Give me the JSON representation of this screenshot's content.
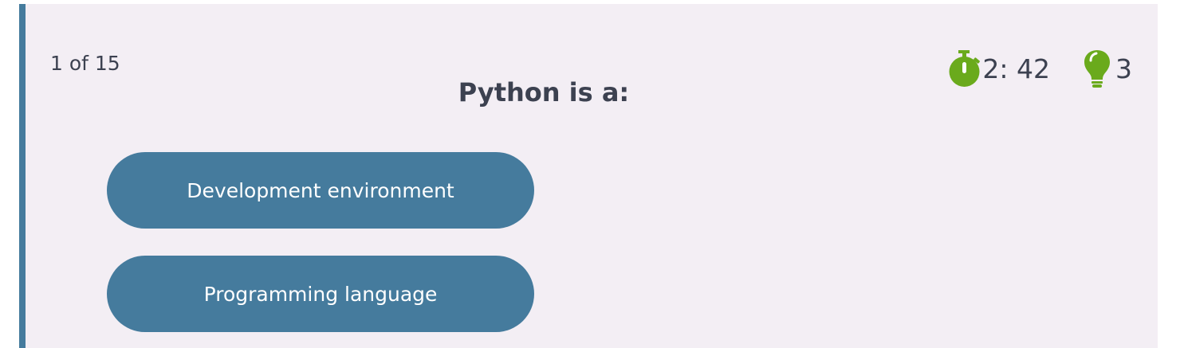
{
  "quiz": {
    "progress": "1 of 15",
    "question": "Python is a:",
    "timer": {
      "icon": "stopwatch-icon",
      "value": "2: 42"
    },
    "hints": {
      "icon": "lightbulb-icon",
      "count": "3"
    },
    "answers": [
      {
        "label": "Development environment"
      },
      {
        "label": "Programming language"
      }
    ]
  },
  "colors": {
    "card_background": "#f3eef4",
    "accent": "#457b9d",
    "icon_green": "#6aaa1c",
    "text": "#3c4150"
  }
}
